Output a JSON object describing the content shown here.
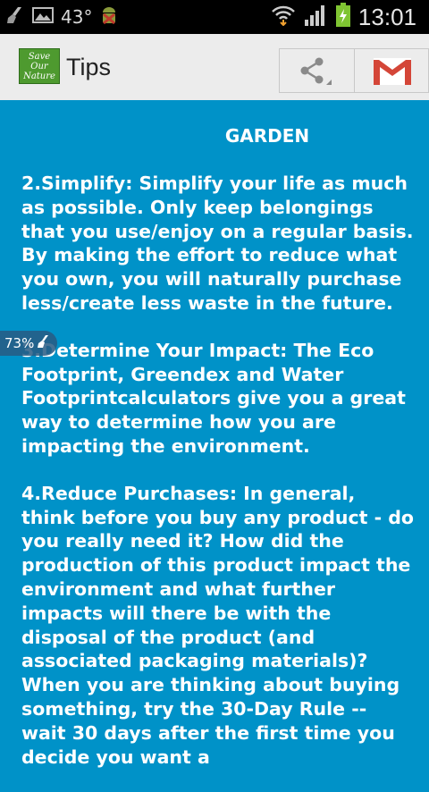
{
  "status_bar": {
    "temperature": "43°",
    "time": "13:01",
    "icons": [
      "broom-icon",
      "image-icon",
      "android-debug-icon",
      "wifi-icon",
      "signal-icon",
      "battery-charging-icon"
    ]
  },
  "action_bar": {
    "app_logo_lines": [
      "Save",
      "Our",
      "Nature"
    ],
    "title": "Tips",
    "share_icon": "share-icon",
    "gmail_icon": "gmail-icon",
    "colors": {
      "background": "#ececec",
      "gmail_red": "#d44638"
    }
  },
  "content": {
    "background": "#0092c8",
    "heading": "GARDEN",
    "tips": [
      "2.Simplify: Simplify your life as much as possible. Only keep belongings that you use/enjoy on a regular basis. By making the effort to reduce what you own, you will naturally purchase less/create less waste in the future.",
      "3.Determine Your Impact: The Eco Footprint, Greendex and Water Footprintcalculators give you a great way to determine how you are impacting the environment.",
      "4.Reduce Purchases: In general, think before you buy any product - do you really need it? How did the production of this product impact the environment and what further impacts will there be with the disposal of the product (and associated packaging materials)? When you are thinking about buying something, try the 30-Day Rule -- wait 30 days after the first time you decide you want a"
    ]
  },
  "overlay": {
    "battery_percent": "73%",
    "icon": "broom-icon"
  }
}
